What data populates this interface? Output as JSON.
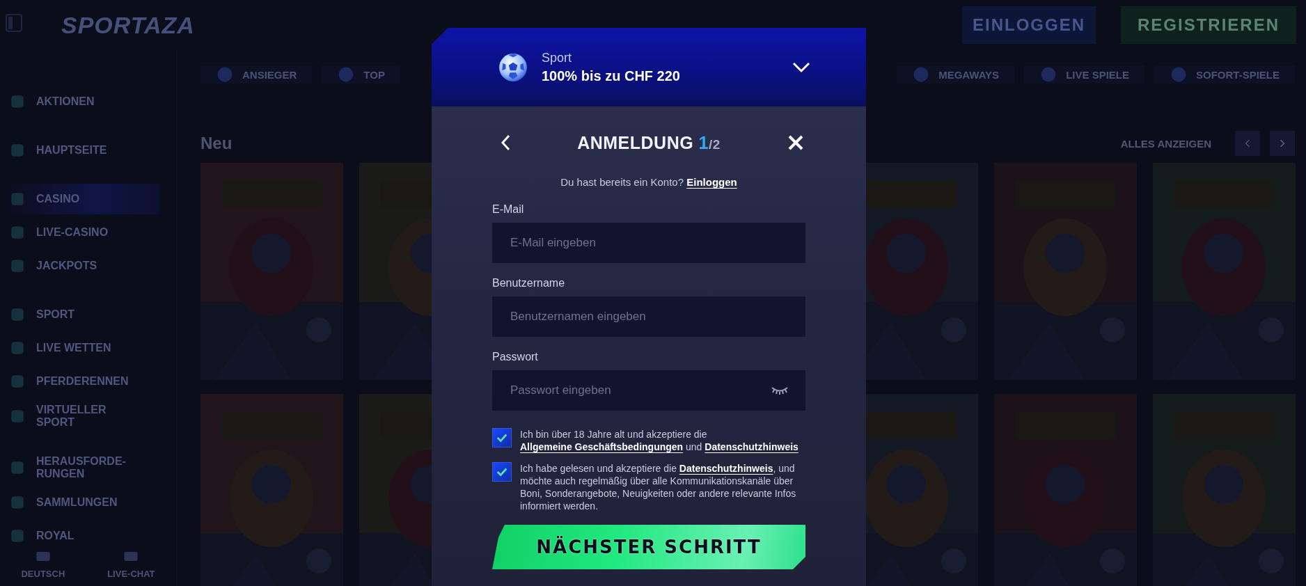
{
  "header": {
    "logo": "SPORTAZA",
    "buttons": [
      {
        "label": "EINLOGGEN",
        "kind": "login"
      },
      {
        "label": "REGISTRIEREN",
        "kind": "register"
      }
    ]
  },
  "sidebar": {
    "groups": [
      [
        {
          "label": "AKTIONEN",
          "selected": false
        }
      ],
      [
        {
          "label": "HAUPTSEITE",
          "selected": false
        }
      ],
      [
        {
          "label": "CASINO",
          "selected": true
        },
        {
          "label": "LIVE-CASINO",
          "selected": false
        },
        {
          "label": "JACKPOTS",
          "selected": false
        }
      ],
      [
        {
          "label": "SPORT",
          "selected": false
        },
        {
          "label": "LIVE WETTEN",
          "selected": false
        },
        {
          "label": "PFERDERENNEN",
          "selected": false
        },
        {
          "label": "VIRTUELLER SPORT",
          "selected": false
        }
      ],
      [
        {
          "label": "HERAUSFORDE-RUNGEN",
          "selected": false
        },
        {
          "label": "SAMMLUNGEN",
          "selected": false
        },
        {
          "label": "ROYAL",
          "selected": false
        }
      ]
    ],
    "footer": [
      "DEUTSCH",
      "LIVE-CHAT"
    ]
  },
  "categories_left": [
    "ANSIEGER",
    "TOP"
  ],
  "categories_right": [
    "MEGAWAYS",
    "LIVE SPIELE",
    "SOFORT-SPIELE"
  ],
  "section": {
    "title": "Neu",
    "show_all": "ALLES ANZEIGEN"
  },
  "games": [
    {
      "kind": "picture"
    },
    {
      "kind": "picture"
    },
    {
      "kind": "picture"
    },
    {
      "kind": "picture"
    },
    {
      "kind": "picture"
    },
    {
      "kind": "picture"
    },
    {
      "kind": "picture"
    },
    {
      "kind": "picture"
    },
    {
      "kind": "picture"
    },
    {
      "kind": "picture"
    }
  ],
  "modal": {
    "bonus": {
      "category": "Sport",
      "offer": "100% bis zu CHF 220"
    },
    "title": "ANMELDUNG",
    "step": "1",
    "total": "/2",
    "login_prompt": "Du hast bereits ein Konto?",
    "login_link": "Einloggen",
    "fields": [
      {
        "label": "E-Mail",
        "placeholder": "E-Mail eingeben",
        "kind": "text"
      },
      {
        "label": "Benutzername",
        "placeholder": "Benutzernamen eingeben",
        "kind": "text"
      },
      {
        "label": "Passwort",
        "placeholder": "Passwort eingeben",
        "kind": "password"
      }
    ],
    "consents": [
      {
        "checked": true,
        "segments": [
          {
            "text": "Ich bin über 18 Jahre alt und akzeptiere die ",
            "link": false
          },
          {
            "text": "Allgemeine Geschäftsbedingungen",
            "link": true
          },
          {
            "text": " und ",
            "link": false
          },
          {
            "text": "Datenschutzhinweis",
            "link": true
          }
        ]
      },
      {
        "checked": true,
        "segments": [
          {
            "text": "Ich habe gelesen und akzeptiere die ",
            "link": false
          },
          {
            "text": "Datenschutzhinweis",
            "link": true
          },
          {
            "text": ", und möchte auch regelmäßig über alle Kommunikationskanäle über Boni, Sonderangebote, Neuigkeiten oder andere relevante Infos informiert werden.",
            "link": false
          }
        ]
      }
    ],
    "submit": "NÄCHSTER SCHRITT"
  }
}
